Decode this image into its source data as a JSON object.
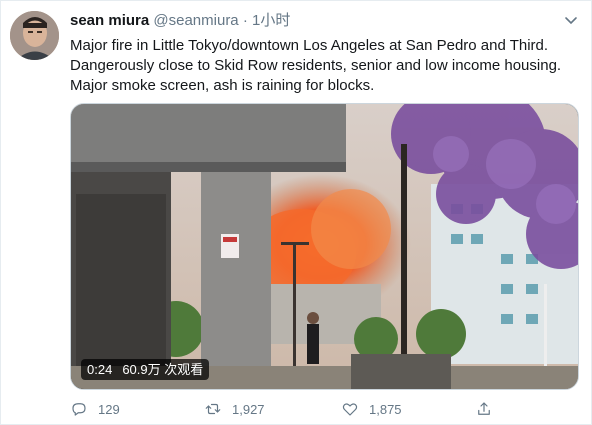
{
  "tweet": {
    "author_name": "sean miura",
    "author_handle": "@seanmiura",
    "separator": "·",
    "time": "1小时",
    "lines": [
      "Major fire in Little Tokyo/downtown Los Angeles at San Pedro and Third.",
      "Dangerously close to Skid Row residents, senior and low income housing.",
      "Major smoke screen, ash is raining for blocks."
    ]
  },
  "video": {
    "duration": "0:24",
    "views": "60.9万 次观看"
  },
  "actions": {
    "reply_count": "129",
    "retweet_count": "1,927",
    "like_count": "1,875"
  },
  "icons": {
    "reply": "reply-icon",
    "retweet": "retweet-icon",
    "like": "like-icon",
    "share": "share-icon",
    "caret": "chevron-down-icon"
  },
  "colors": {
    "text": "#14171a",
    "secondary": "#657786",
    "border": "#e6ecf0"
  }
}
